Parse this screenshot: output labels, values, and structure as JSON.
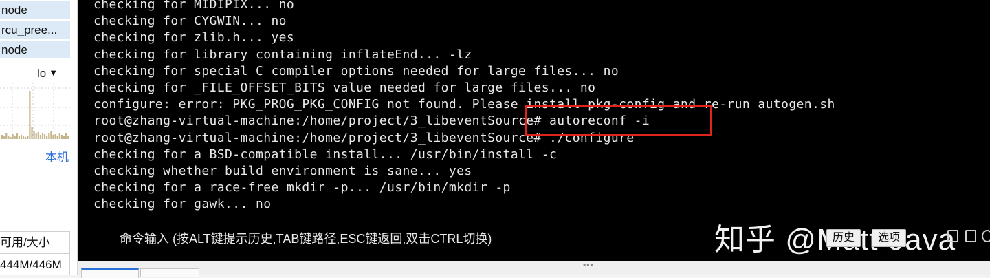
{
  "left_panel": {
    "process_rows": [
      "node",
      "rcu_pree...",
      "node"
    ],
    "sort_dropdown": {
      "label": "lo",
      "icon": "caret-down-icon"
    },
    "mini_chart": {
      "color": "#c4b48a"
    },
    "local_link": "本机",
    "mem_header": "可用/大小",
    "mem_value": "444M/446M"
  },
  "terminal": {
    "lines": [
      "checking for MIDIPIX... no",
      "checking for CYGWIN... no",
      "checking for zlib.h... yes",
      "checking for library containing inflateEnd... -lz",
      "checking for special C compiler options needed for large files... no",
      "checking for _FILE_OFFSET_BITS value needed for large files... no",
      "configure: error: PKG_PROG_PKG_CONFIG not found. Please install pkg-config and re-run autogen.sh",
      "root@zhang-virtual-machine:/home/project/3_libeventSource# autoreconf -i",
      "root@zhang-virtual-machine:/home/project/3_libeventSource# ./configure",
      "checking for a BSD-compatible install... /usr/bin/install -c",
      "checking whether build environment is sane... yes",
      "checking for a race-free mkdir -p... /usr/bin/mkdir -p",
      "checking for gawk... no"
    ],
    "highlight_color": "#e0241c",
    "command_hint": "命令输入 (按ALT键提示历史,TAB键路径,ESC键返回,双击CTRL切换)",
    "history_button": "历史",
    "options_button": "选项",
    "watermark": "知乎 @Matt-Java"
  }
}
